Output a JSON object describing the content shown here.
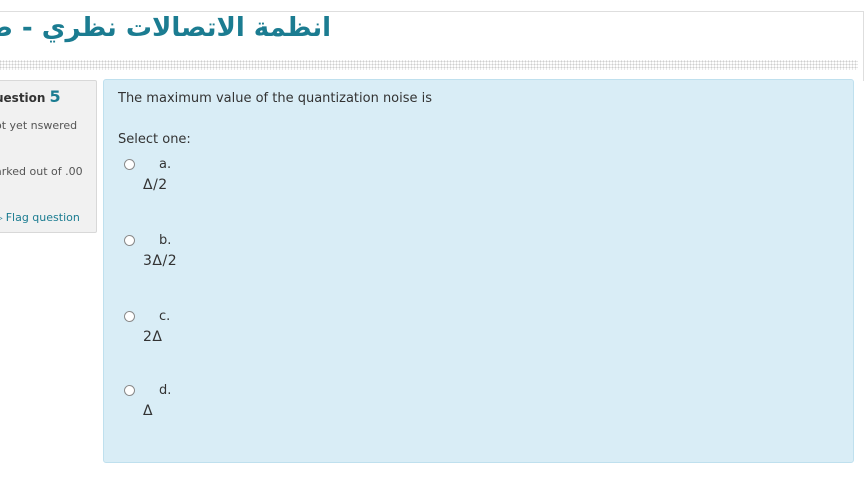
{
  "course": {
    "title": "انظمة الاتصالات نظري - طولكرم"
  },
  "question_info": {
    "label": "uestion",
    "number": "5",
    "state": "ot yet nswered",
    "mark": "arked out of .00",
    "flag_label": "Flag question"
  },
  "question": {
    "text": "The maximum value of the quantization noise is",
    "prompt": "Select one:",
    "answers": [
      {
        "letter": "a.",
        "value": "Δ/2",
        "selected": false
      },
      {
        "letter": "b.",
        "value": "3Δ/2",
        "selected": false
      },
      {
        "letter": "c.",
        "value": "2Δ",
        "selected": false
      },
      {
        "letter": "d.",
        "value": "Δ",
        "selected": false
      }
    ]
  },
  "colors": {
    "accent": "#1b7c91",
    "content_bg": "#d9edf6",
    "info_bg": "#f1f1f1"
  },
  "icons": {
    "flag": "flag-icon"
  }
}
